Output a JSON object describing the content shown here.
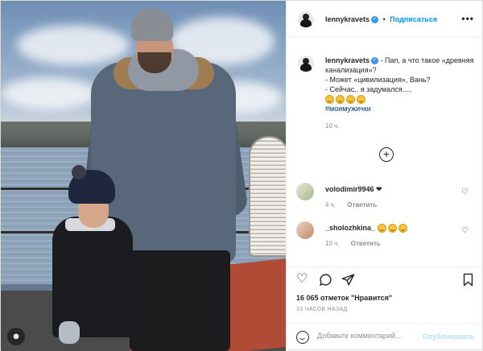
{
  "post": {
    "author": "lennykravets",
    "follow_separator": "•",
    "follow_label": "Подписаться",
    "more_label": "•••"
  },
  "caption": {
    "author": "lennykravets",
    "lines": [
      "- Пап, а что такое «древняя канализация»?",
      "- Может «цивилизация», Вань?",
      "- Сейчас.. я задумался....."
    ],
    "emoji_count": 4,
    "hashtag": "#моимужички",
    "time": "10 ч."
  },
  "comments": [
    {
      "user": "volodimir9946",
      "text": "❤",
      "time": "4 ч.",
      "reply": "Ответить"
    },
    {
      "user": "_sholozhkina_",
      "text": "",
      "emoji_count": 3,
      "time": "10 ч.",
      "reply": "Ответить"
    }
  ],
  "actions": {
    "likes": "16 065 отметок \"Нравится\"",
    "time_ago": "10 ЧАСОВ НАЗАД"
  },
  "comment_box": {
    "placeholder": "Добавьте комментарий...",
    "publish_label": "Опубликовать"
  },
  "colors": {
    "link_blue": "#0095f6",
    "publish_disabled": "#b2dffc",
    "hashtag": "#00376b",
    "muted": "#8e8e8e"
  },
  "icons": [
    "heart-icon",
    "comment-icon",
    "share-icon",
    "bookmark-icon",
    "emoji-icon",
    "verified-icon",
    "plus-circle-icon",
    "user-tag-icon"
  ]
}
